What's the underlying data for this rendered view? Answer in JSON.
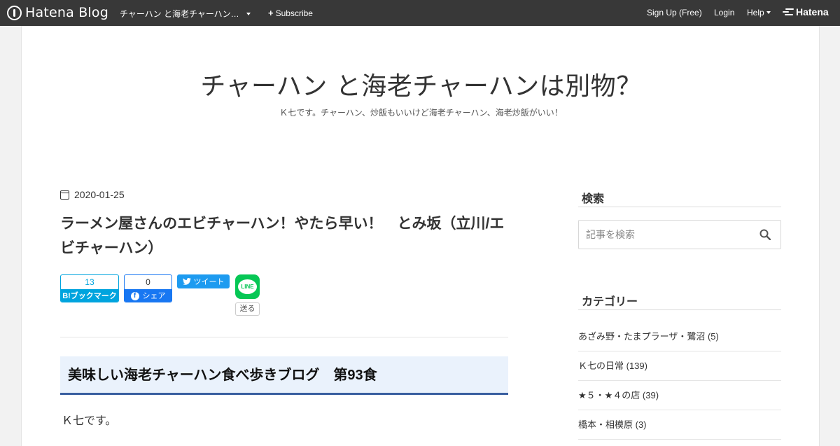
{
  "navbar": {
    "logo_text": "Hatena Blog",
    "blog_selector": "チャーハン と海老チャーハン…",
    "subscribe_label": "Subscribe",
    "signup_label": "Sign Up (Free)",
    "login_label": "Login",
    "help_label": "Help",
    "brand_label": "Hatena"
  },
  "blog": {
    "title": "チャーハン と海老チャーハンは別物？",
    "description": "Ｋ七です。チャーハン、炒飯もいいけど海老チャーハン、海老炒飯がいい！"
  },
  "article": {
    "date": "2020-01-25",
    "title": "ラーメン屋さんのエビチャーハン！やたら早い！　とみ坂（立川/エビチャーハン）",
    "share": {
      "hatena_count": "13",
      "hatena_label": "B!ブックマーク",
      "facebook_count": "0",
      "facebook_label": "シェア",
      "tweet_label": "ツイート",
      "line_label": "LINE",
      "line_send_label": "送る"
    },
    "section_heading": "美味しい海老チャーハン食べ歩きブログ　第93食",
    "body_first_line": "Ｋ七です。"
  },
  "sidebar": {
    "search_title": "検索",
    "search_placeholder": "記事を検索",
    "category_title": "カテゴリー",
    "categories": [
      {
        "label": "あざみ野・たまプラーザ・鷺沼 (5)"
      },
      {
        "label": "Ｋ七の日常 (139)"
      },
      {
        "label": "★５・★４の店 (39)"
      },
      {
        "label": "橋本・相模原 (3)"
      }
    ]
  },
  "colors": {
    "navbar_bg": "#383838",
    "hatena_blue": "#00a4de",
    "facebook_blue": "#1877f2",
    "twitter_blue": "#1d9bf0",
    "line_green": "#06c755",
    "heading_bg": "#eaf2fc",
    "heading_border": "#3a5fa0"
  }
}
